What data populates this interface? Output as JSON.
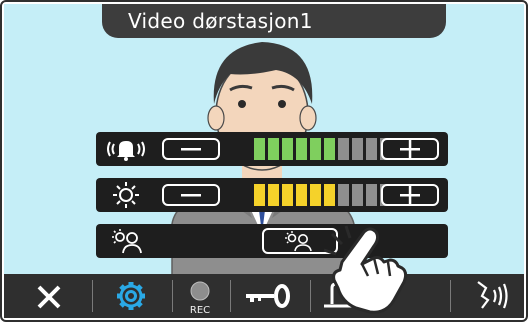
{
  "window": {
    "title": "Video dørstasjon1"
  },
  "controls": {
    "volume": {
      "icon": "speaker-volume-icon",
      "minus_icon": "minus-icon",
      "plus_icon": "plus-icon",
      "level": 6,
      "max": 10,
      "color": "#7fcf5e"
    },
    "brightness": {
      "icon": "brightness-sun-icon",
      "minus_icon": "minus-icon",
      "plus_icon": "plus-icon",
      "level": 6,
      "max": 10,
      "color": "#f5d22a"
    },
    "backlight": {
      "icon": "backlight-person-icon",
      "toggle_icon": "backlight-compensation-icon"
    }
  },
  "toolbar": {
    "buttons": [
      {
        "name": "close-button",
        "icon": "close-icon"
      },
      {
        "name": "settings-button",
        "icon": "gear-icon",
        "color": "#2aa9e6"
      },
      {
        "name": "record-button",
        "icon": "record-icon",
        "label": "REC"
      },
      {
        "name": "unlock-door-button",
        "icon": "key-icon"
      },
      {
        "name": "door-release-button",
        "icon": "door-release-icon"
      },
      {
        "name": "talk-button",
        "icon": "talk-icon"
      }
    ]
  },
  "colors": {
    "segment_off": "#8f8f8f",
    "panel": "#1e1e1e",
    "background": "#c5eef7"
  }
}
